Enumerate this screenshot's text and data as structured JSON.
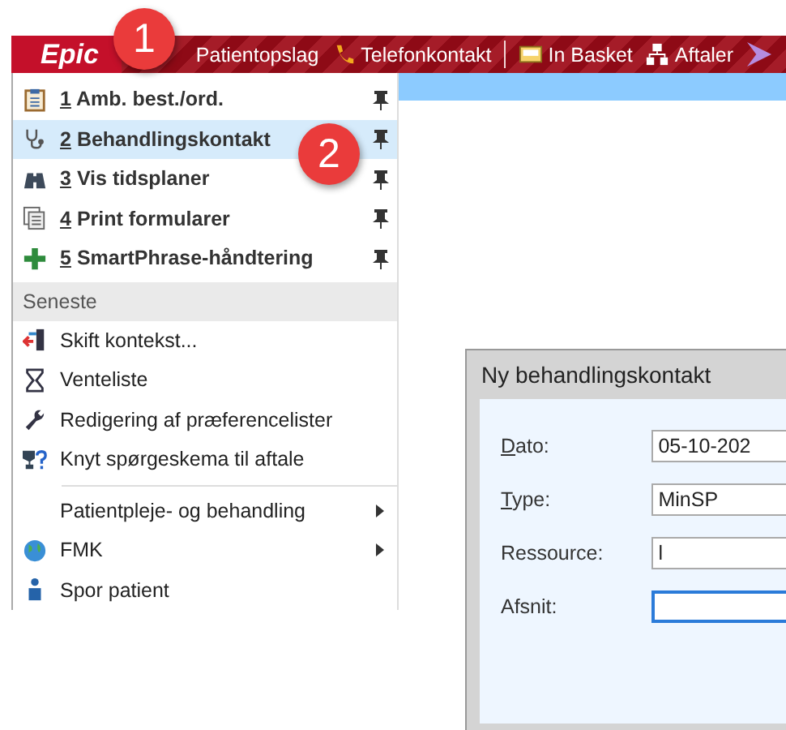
{
  "toolbar": {
    "logo": "Epic",
    "items": [
      {
        "kind": "plain",
        "label": "Patientopslag"
      },
      {
        "kind": "phone",
        "label": "Telefonkontakt"
      },
      {
        "kind": "separator"
      },
      {
        "kind": "inbox",
        "label": "In Basket"
      },
      {
        "kind": "network",
        "label": "Aftaler"
      },
      {
        "kind": "purple"
      }
    ]
  },
  "menu": {
    "pinned": [
      {
        "kind": "clipboard",
        "number": "1",
        "label": "Amb. best./ord.",
        "selected": false
      },
      {
        "kind": "stethoscope",
        "number": "2",
        "label": "Behandlingskontakt",
        "selected": true
      },
      {
        "kind": "binoculars",
        "number": "3",
        "label": "Vis tidsplaner",
        "selected": false
      },
      {
        "kind": "pages",
        "number": "4",
        "label": "Print formularer",
        "selected": false
      },
      {
        "kind": "plus",
        "number": "5",
        "label": "SmartPhrase-håndtering",
        "selected": false
      }
    ],
    "section": "Seneste",
    "recent": [
      {
        "kind": "switch",
        "label": "Skift kontekst..."
      },
      {
        "kind": "hourglass",
        "label": "Venteliste"
      },
      {
        "kind": "wrench",
        "label": "Redigering af præferencelister"
      },
      {
        "kind": "question",
        "label": "Knyt spørgeskema til aftale"
      }
    ],
    "more": [
      {
        "label": "Patientpleje- og behandling",
        "submenu": true
      },
      {
        "kind": "globe",
        "label": "FMK",
        "submenu": true
      },
      {
        "kind": "person",
        "label": "Spor patient",
        "submenu": false
      }
    ]
  },
  "dialog": {
    "title": "Ny behandlingskontakt",
    "fields": [
      {
        "label": "Dato:",
        "underline_first": true,
        "value": "05-10-202",
        "focused": false
      },
      {
        "label": "Type:",
        "underline_first": true,
        "value": "MinSP",
        "focused": false
      },
      {
        "label": "Ressource:",
        "underline_first": false,
        "value": "l",
        "focused": false
      },
      {
        "label": "Afsnit:",
        "underline_first": false,
        "focused": true
      }
    ]
  },
  "callouts": [
    "1",
    "2"
  ]
}
